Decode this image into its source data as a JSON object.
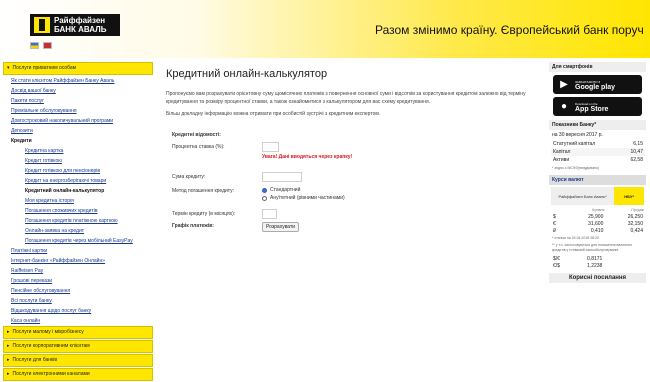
{
  "header": {
    "logo_line1": "Райффайзен",
    "logo_line2": "БАНК АВАЛЬ",
    "slogan": "Разом змінимо країну. Європейський банк поруч"
  },
  "left_nav": {
    "top_section": "Послуги приватним особам",
    "items": [
      {
        "label": "Як стати клієнтом Райффайзен Банку Аваль",
        "level": 0,
        "bold": false
      },
      {
        "label": "Досвід вашої банку",
        "level": 0,
        "bold": false
      },
      {
        "label": "Пакети послуг",
        "level": 0,
        "bold": false
      },
      {
        "label": "Преміальне обслуговування",
        "level": 0,
        "bold": false
      },
      {
        "label": "Довгостроковий накопичувальний програми",
        "level": 0,
        "bold": false
      },
      {
        "label": "Депозити",
        "level": 0,
        "bold": false
      },
      {
        "label": "Кредити",
        "level": 0,
        "bold": true
      },
      {
        "label": "Кредитна картка",
        "level": 1,
        "bold": false
      },
      {
        "label": "Кредит готівкою",
        "level": 1,
        "bold": false
      },
      {
        "label": "Кредит готівкою для пенсіонерів",
        "level": 1,
        "bold": false
      },
      {
        "label": "Кредит на енергозберігаючі товари",
        "level": 1,
        "bold": false
      },
      {
        "label": "Кредитний онлайн-калькулятор",
        "level": 1,
        "bold": true
      },
      {
        "label": "Моя кредитна історія",
        "level": 1,
        "bold": false
      },
      {
        "label": "Погашення споживчих кредитів",
        "level": 1,
        "bold": false
      },
      {
        "label": "Погашення кредитів платіжною карткою",
        "level": 1,
        "bold": false
      },
      {
        "label": "Онлайн-заявка на кредит",
        "level": 1,
        "bold": false
      },
      {
        "label": "Погашення кредитів через мобільний EasyPay",
        "level": 1,
        "bold": false
      },
      {
        "label": "Платіжні картки",
        "level": 0,
        "bold": false
      },
      {
        "label": "Інтернет-банкінг «Райффайзен Онлайн»",
        "level": 0,
        "bold": false
      },
      {
        "label": "Raiffeisen Pay",
        "level": 0,
        "bold": false
      },
      {
        "label": "Грошові перекази",
        "level": 0,
        "bold": false
      },
      {
        "label": "Пенсійне обслуговування",
        "level": 0,
        "bold": false
      },
      {
        "label": "Всі послуги банку",
        "level": 0,
        "bold": false
      },
      {
        "label": "Відшкодування щодо послуг банку",
        "level": 0,
        "bold": false
      },
      {
        "label": "Каса онлайн",
        "level": 0,
        "bold": false
      }
    ],
    "bottom_sections": [
      "Послуги малому і мікробізнесу",
      "Послуги корпоративним клієнтам",
      "Послуги для банків",
      "Послуги електронними каналами"
    ]
  },
  "main": {
    "title": "Кредитний онлайн-калькулятор",
    "intro_1": "Пропонуємо вам розрахувати орієнтовну суму щомісячних платежів з повернення основної суми і відсотків за користування кредитом залежно від терміну кредитування та розміру процентної ставки, а також ознайомитися з калькулятором для вас схему кредитування.",
    "intro_2": "Більш докладну інформацію можна отримати при особистій зустрічі з кредитним експертом.",
    "form": {
      "section_label": "Кредитні відомості:",
      "rate_label": "Процентна ставка (%):",
      "rate_value": "",
      "warning": "Увага! Дані вводяться через крапку!",
      "amount_label": "Сума кредиту:",
      "amount_value": "",
      "method_label": "Метод погашення кредиту:",
      "method_options": [
        "Стандартний",
        "Ануїтетний (рівними частинами)"
      ],
      "method_selected": 0,
      "term_label": "Термін кредиту (в місяцях):",
      "term_value": "",
      "schedule_label": "Графік платежів:",
      "calc_button": "Розрахувати"
    }
  },
  "right": {
    "apps_title": "Для смартфонів",
    "gplay_small": "ЗАВАНТАЖИТИ З",
    "gplay_big": "Google play",
    "appstore_small": "Download on the",
    "appstore_big": "App Store",
    "indicators_title": "Показники Банку*",
    "indicators_date": "на 30 вересня 2017 р.",
    "indicators": [
      {
        "label": "Статутний капітал",
        "value": "6,15"
      },
      {
        "label": "Капітал",
        "value": "10,47"
      },
      {
        "label": "Активи",
        "value": "62,58"
      }
    ],
    "indicators_note": "* згідно з МСФЗ(неаудовано)",
    "currency_title": "Курси валют",
    "currency_tab1": "Райффайзен Банк Аваль*",
    "currency_tab2": "НБУ*",
    "currency_cols": [
      "Купівля",
      "Продаж"
    ],
    "rates": [
      {
        "code": "$",
        "buy": "25,900",
        "sell": "26,250"
      },
      {
        "code": "€",
        "buy": "31,600",
        "sell": "32,150"
      },
      {
        "code": "₽",
        "buy": "0,410",
        "sell": "0,424"
      }
    ],
    "rates_note1": "* станом на 24.04.2018 08:20",
    "rates_note2": "** у т.ч. застосовуються для погашення валютних кредитів у готівковій самообслуговуванні",
    "cross_rates": [
      {
        "label": "$/€",
        "value": "0,8171"
      },
      {
        "label": "€/$",
        "value": "1,2238"
      }
    ],
    "links_title": "Корисні посилання"
  }
}
